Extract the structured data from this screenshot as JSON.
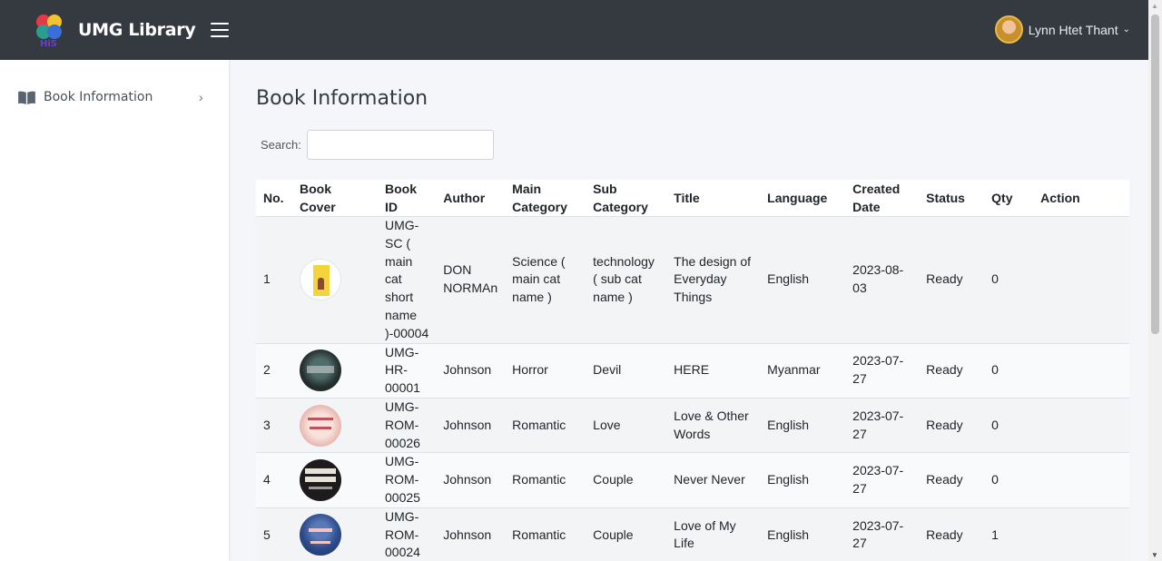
{
  "app": {
    "title": "UMG Library",
    "logo_text": "HiS"
  },
  "user": {
    "name": "Lynn Htet Thant"
  },
  "sidebar": {
    "items": [
      {
        "label": "Book Information"
      }
    ]
  },
  "page": {
    "title": "Book Information",
    "search_label": "Search:",
    "search_value": ""
  },
  "table": {
    "headers": [
      "No.",
      "Book Cover",
      "Book ID",
      "Author",
      "Main Category",
      "Sub Category",
      "Title",
      "Language",
      "Created Date",
      "Status",
      "Qty",
      "Action"
    ],
    "rows": [
      {
        "no": "1",
        "cover": "cover-design-everyday-things",
        "book_id": "UMG-SC ( main cat short name )-00004",
        "author": "DON NORMAn",
        "main_category": "Science ( main cat name )",
        "sub_category": "technology ( sub cat name )",
        "title": "The design of Everyday Things",
        "language": "English",
        "created_date": "2023-08-03",
        "status": "Ready",
        "qty": "0",
        "action": ""
      },
      {
        "no": "2",
        "cover": "cover-here-lies-arthur",
        "book_id": "UMG-HR-00001",
        "author": "Johnson",
        "main_category": "Horror",
        "sub_category": "Devil",
        "title": "HERE",
        "language": "Myanmar",
        "created_date": "2023-07-27",
        "status": "Ready",
        "qty": "0",
        "action": ""
      },
      {
        "no": "3",
        "cover": "cover-love-and-other-words",
        "book_id": "UMG-ROM-00026",
        "author": "Johnson",
        "main_category": "Romantic",
        "sub_category": "Love",
        "title": "Love & Other Words",
        "language": "English",
        "created_date": "2023-07-27",
        "status": "Ready",
        "qty": "0",
        "action": ""
      },
      {
        "no": "4",
        "cover": "cover-never-never",
        "book_id": "UMG-ROM-00025",
        "author": "Johnson",
        "main_category": "Romantic",
        "sub_category": "Couple",
        "title": "Never Never",
        "language": "English",
        "created_date": "2023-07-27",
        "status": "Ready",
        "qty": "0",
        "action": ""
      },
      {
        "no": "5",
        "cover": "cover-love-of-my-life",
        "book_id": "UMG-ROM-00024",
        "author": "Johnson",
        "main_category": "Romantic",
        "sub_category": "Couple",
        "title": "Love of My Life",
        "language": "English",
        "created_date": "2023-07-27",
        "status": "Ready",
        "qty": "1",
        "action": ""
      }
    ]
  },
  "colors": {
    "navbar": "#343a40",
    "sidebar": "#ffffff",
    "content_bg": "#f4f6f9"
  }
}
